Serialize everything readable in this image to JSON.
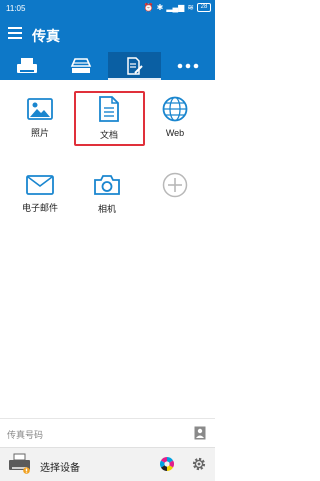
{
  "status_bar": {
    "time": "11:05",
    "battery": "28"
  },
  "app_bar": {
    "title": "传真"
  },
  "tabs": [
    {
      "icon": "fax-machine-icon",
      "active": false
    },
    {
      "icon": "scanner-icon",
      "active": false
    },
    {
      "icon": "document-edit-icon",
      "active": true
    },
    {
      "icon": "more-icon",
      "active": false
    }
  ],
  "grid": {
    "items": [
      {
        "label": "照片",
        "icon": "photo-icon"
      },
      {
        "label": "文档",
        "icon": "document-icon",
        "highlighted": true
      },
      {
        "label": "Web",
        "icon": "globe-icon"
      },
      {
        "label": "电子邮件",
        "icon": "email-icon"
      },
      {
        "label": "相机",
        "icon": "camera-icon"
      },
      {
        "label": "",
        "icon": "add-icon"
      }
    ]
  },
  "fax_number": {
    "placeholder": "传真号码"
  },
  "device": {
    "label": "选择设备"
  },
  "colors": {
    "primary": "#0d78c8",
    "primary_dark": "#0a5fa3",
    "highlight": "#e0303a",
    "icon_blue": "#1a86cf"
  }
}
